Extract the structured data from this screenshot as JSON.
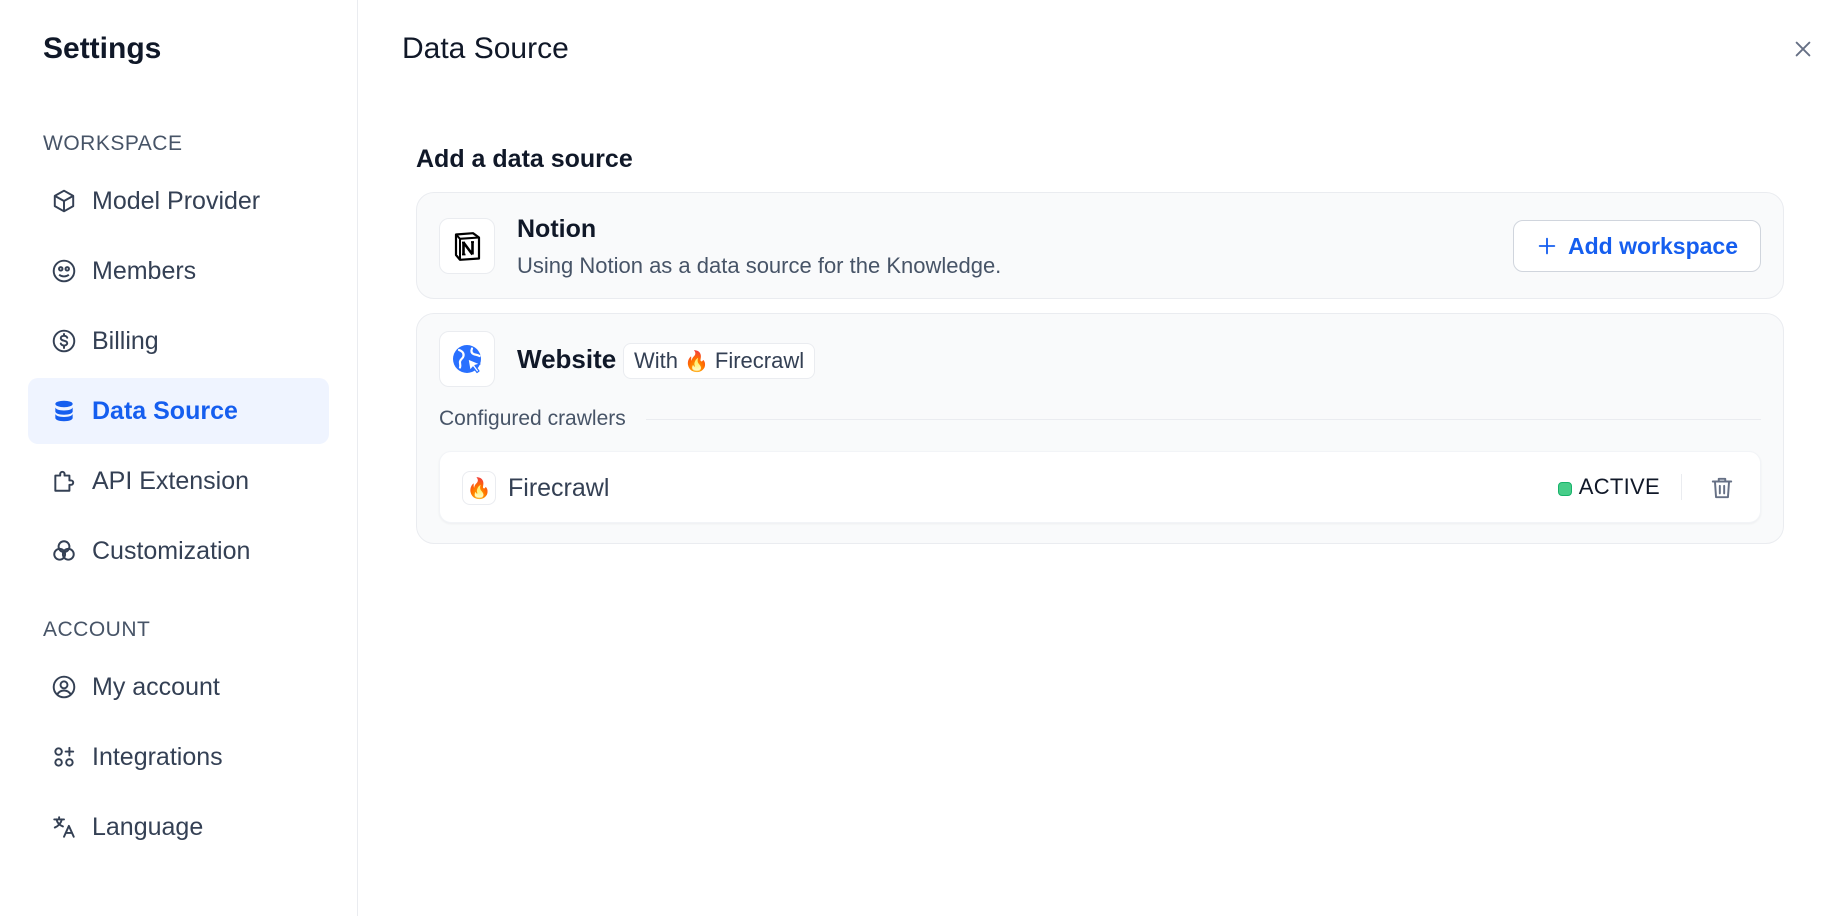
{
  "sidebar": {
    "title": "Settings",
    "workspace_label": "WORKSPACE",
    "account_label": "ACCOUNT",
    "workspace_items": [
      {
        "label": "Model Provider",
        "icon": "cube-icon"
      },
      {
        "label": "Members",
        "icon": "members-icon"
      },
      {
        "label": "Billing",
        "icon": "billing-icon"
      },
      {
        "label": "Data Source",
        "icon": "database-icon",
        "active": true
      },
      {
        "label": "API Extension",
        "icon": "puzzle-icon"
      },
      {
        "label": "Customization",
        "icon": "customization-icon"
      }
    ],
    "account_items": [
      {
        "label": "My account",
        "icon": "user-circle-icon"
      },
      {
        "label": "Integrations",
        "icon": "integrations-icon"
      },
      {
        "label": "Language",
        "icon": "language-icon"
      }
    ]
  },
  "main": {
    "title": "Data Source",
    "section_heading": "Add a data source",
    "notion": {
      "title": "Notion",
      "description": "Using Notion as a data source for the Knowledge.",
      "add_button": "Add workspace"
    },
    "website": {
      "title": "Website",
      "badge_prefix": "With",
      "badge_emoji": "🔥",
      "badge_provider": "Firecrawl",
      "crawlers_label": "Configured crawlers",
      "crawlers": [
        {
          "emoji": "🔥",
          "name": "Firecrawl",
          "status": "ACTIVE"
        }
      ]
    }
  },
  "colors": {
    "accent": "#155eef",
    "active_bg": "#eff4ff",
    "status_active": "#47cd89"
  }
}
